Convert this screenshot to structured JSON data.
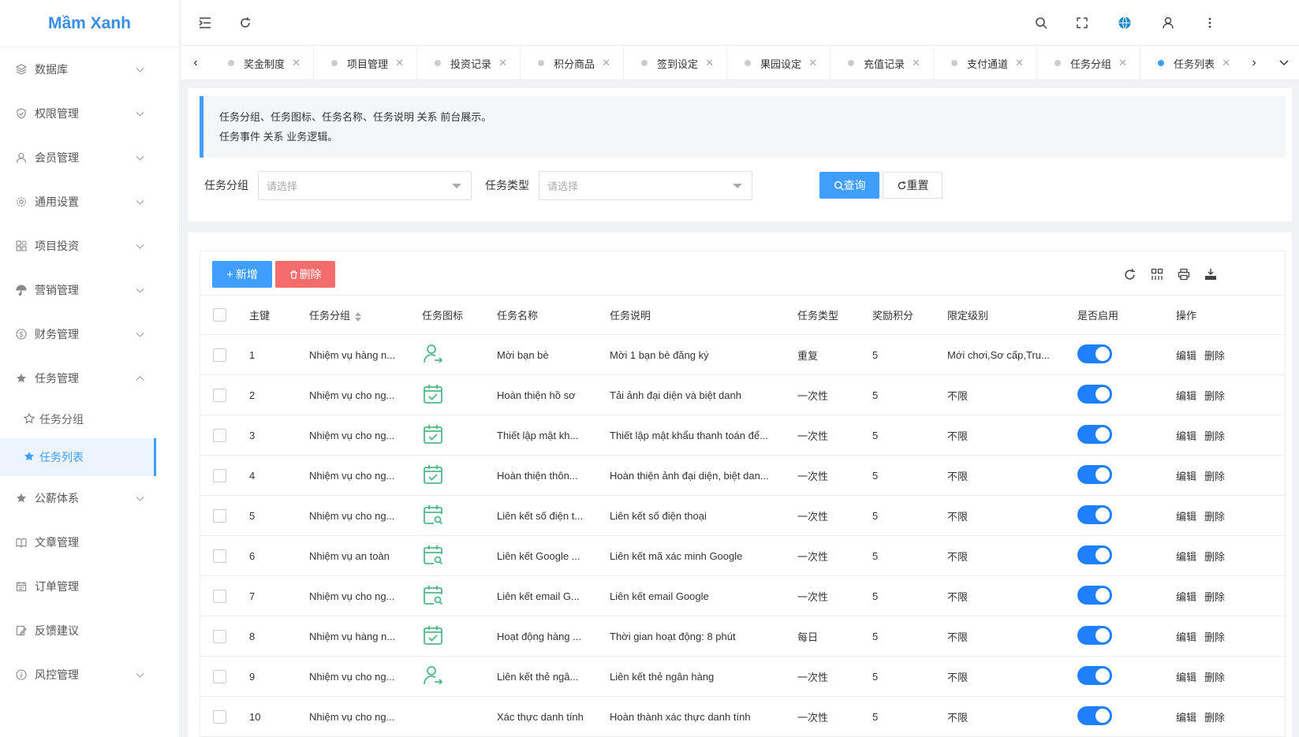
{
  "app": {
    "logo": "Mầm Xanh"
  },
  "sidebar": {
    "items": [
      {
        "label": "数据库",
        "icon": "database-icon",
        "has_arrow": true
      },
      {
        "label": "权限管理",
        "icon": "shield-icon",
        "has_arrow": true
      },
      {
        "label": "会员管理",
        "icon": "user-icon",
        "has_arrow": true
      },
      {
        "label": "通用设置",
        "icon": "gear-icon",
        "has_arrow": true
      },
      {
        "label": "项目投资",
        "icon": "apps-icon",
        "has_arrow": true
      },
      {
        "label": "营销管理",
        "icon": "umbrella-icon",
        "has_arrow": true
      },
      {
        "label": "财务管理",
        "icon": "dollar-icon",
        "has_arrow": true
      },
      {
        "label": "任务管理",
        "icon": "star-icon",
        "has_arrow": true,
        "expanded": true
      },
      {
        "label": "公薪体系",
        "icon": "star-icon",
        "has_arrow": true
      },
      {
        "label": "文章管理",
        "icon": "book-icon",
        "has_arrow": false
      },
      {
        "label": "订单管理",
        "icon": "calendar-icon",
        "has_arrow": false
      },
      {
        "label": "反馈建议",
        "icon": "edit-icon",
        "has_arrow": false
      },
      {
        "label": "风控管理",
        "icon": "info-icon",
        "has_arrow": true
      }
    ],
    "sub_items": [
      {
        "label": "任务分组",
        "icon": "star-outline-icon",
        "active": false
      },
      {
        "label": "任务列表",
        "icon": "star-icon",
        "active": true
      }
    ]
  },
  "tabs": [
    {
      "label": "奖金制度",
      "active": false
    },
    {
      "label": "项目管理",
      "active": false
    },
    {
      "label": "投资记录",
      "active": false
    },
    {
      "label": "积分商品",
      "active": false
    },
    {
      "label": "签到设定",
      "active": false
    },
    {
      "label": "果园设定",
      "active": false
    },
    {
      "label": "充值记录",
      "active": false
    },
    {
      "label": "支付通道",
      "active": false
    },
    {
      "label": "任务分组",
      "active": false
    },
    {
      "label": "任务列表",
      "active": true
    }
  ],
  "notice": {
    "line1": "任务分组、任务图标、任务名称、任务说明 关系 前台展示。",
    "line2": "任务事件 关系 业务逻辑。"
  },
  "filters": {
    "group_label": "任务分组",
    "group_placeholder": "请选择",
    "type_label": "任务类型",
    "type_placeholder": "请选择",
    "search_button": "查询",
    "reset_button": "重置"
  },
  "toolbar": {
    "add_button": "新增",
    "delete_button": "删除"
  },
  "table": {
    "columns": [
      "主键",
      "任务分组",
      "任务图标",
      "任务名称",
      "任务说明",
      "任务类型",
      "奖励积分",
      "限定级别",
      "是否启用",
      "操作"
    ],
    "actions": {
      "edit": "编辑",
      "delete": "删除"
    },
    "rows": [
      {
        "id": "1",
        "group": "Nhiệm vụ hàng n...",
        "icon": "user-share-icon",
        "name": "Mời bạn bè",
        "desc": "Mời 1 bạn bè đăng ký",
        "type": "重复",
        "points": "5",
        "level": "Mới chơi,Sơ cấp,Tru...",
        "enabled": true
      },
      {
        "id": "2",
        "group": "Nhiệm vụ cho ng...",
        "icon": "calendar-check-icon",
        "name": "Hoàn thiện hồ sơ",
        "desc": "Tải ảnh đại diện và biệt danh",
        "type": "一次性",
        "points": "5",
        "level": "不限",
        "enabled": true
      },
      {
        "id": "3",
        "group": "Nhiệm vụ cho ng...",
        "icon": "calendar-check-icon",
        "name": "Thiết lập mật kh...",
        "desc": "Thiết lập mật khẩu thanh toán để...",
        "type": "一次性",
        "points": "5",
        "level": "不限",
        "enabled": true
      },
      {
        "id": "4",
        "group": "Nhiệm vụ cho ng...",
        "icon": "calendar-check-icon",
        "name": "Hoàn thiện thôn...",
        "desc": "Hoàn thiện ảnh đại diện, biệt dan...",
        "type": "一次性",
        "points": "5",
        "level": "不限",
        "enabled": true
      },
      {
        "id": "5",
        "group": "Nhiệm vụ cho ng...",
        "icon": "calendar-search-icon",
        "name": "Liên kết số điện t...",
        "desc": "Liên kết số điện thoại",
        "type": "一次性",
        "points": "5",
        "level": "不限",
        "enabled": true
      },
      {
        "id": "6",
        "group": "Nhiệm vụ an toàn",
        "icon": "calendar-search-icon",
        "name": "Liên kết Google ...",
        "desc": "Liên kết mã xác minh Google",
        "type": "一次性",
        "points": "5",
        "level": "不限",
        "enabled": true
      },
      {
        "id": "7",
        "group": "Nhiệm vụ cho ng...",
        "icon": "calendar-search-icon",
        "name": "Liên kết email G...",
        "desc": "Liên kết email Google",
        "type": "一次性",
        "points": "5",
        "level": "不限",
        "enabled": true
      },
      {
        "id": "8",
        "group": "Nhiệm vụ hàng n...",
        "icon": "calendar-check-icon",
        "name": "Hoạt động hàng ...",
        "desc": "Thời gian hoạt động: 8 phút",
        "type": "每日",
        "points": "5",
        "level": "不限",
        "enabled": true
      },
      {
        "id": "9",
        "group": "Nhiệm vụ cho ng...",
        "icon": "user-share-icon",
        "name": "Liên kết thẻ ngâ...",
        "desc": "Liên kết thẻ ngân hàng",
        "type": "一次性",
        "points": "5",
        "level": "不限",
        "enabled": true
      },
      {
        "id": "10",
        "group": "Nhiệm vụ cho ng...",
        "icon": "none",
        "name": "Xác thực danh tính",
        "desc": "Hoàn thành xác thực danh tính",
        "type": "一次性",
        "points": "5",
        "level": "不限",
        "enabled": true
      }
    ]
  },
  "colors": {
    "primary": "#409eff",
    "danger": "#f56c6c",
    "toggle": "#1e80ff",
    "icon_green": "#52b788"
  }
}
